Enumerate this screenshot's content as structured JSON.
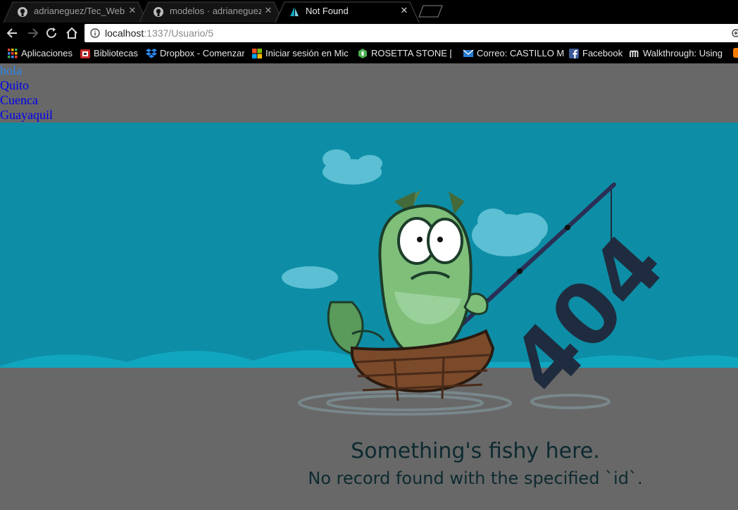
{
  "browser": {
    "tabs": [
      {
        "title": "adrianeguez/Tec_Web",
        "icon": "github-icon",
        "active": false
      },
      {
        "title": "modelos · adrianeguez/",
        "icon": "github-icon",
        "active": false
      },
      {
        "title": "Not Found",
        "icon": "sails-icon",
        "active": true
      }
    ],
    "address": {
      "host": "localhost",
      "path": ":1337/Usuario/5"
    },
    "bookmarks": [
      {
        "label": "Aplicaciones",
        "icon": "apps-grid-icon"
      },
      {
        "label": "Bibliotecas",
        "icon": "library-icon"
      },
      {
        "label": "Dropbox - Comenzar",
        "icon": "dropbox-icon"
      },
      {
        "label": "Iniciar sesión en Mic",
        "icon": "microsoft-icon"
      },
      {
        "label": "ROSETTA STONE [D",
        "icon": "rosetta-stone-icon"
      },
      {
        "label": "Correo: CASTILLO M",
        "icon": "mail-icon"
      },
      {
        "label": "Facebook",
        "icon": "facebook-icon"
      },
      {
        "label": "Walkthrough: Using",
        "icon": "medium-icon"
      }
    ]
  },
  "page": {
    "links": [
      "hola",
      "Quito",
      "Cuenca",
      "Guayaquil"
    ],
    "heading": "Something's fishy here.",
    "subheading": "No record found with the specified `id`.",
    "illustration_text": "404"
  },
  "colors": {
    "sky": "#0d8ea6",
    "page_bg": "#686868",
    "message_text": "#0d2a30"
  }
}
